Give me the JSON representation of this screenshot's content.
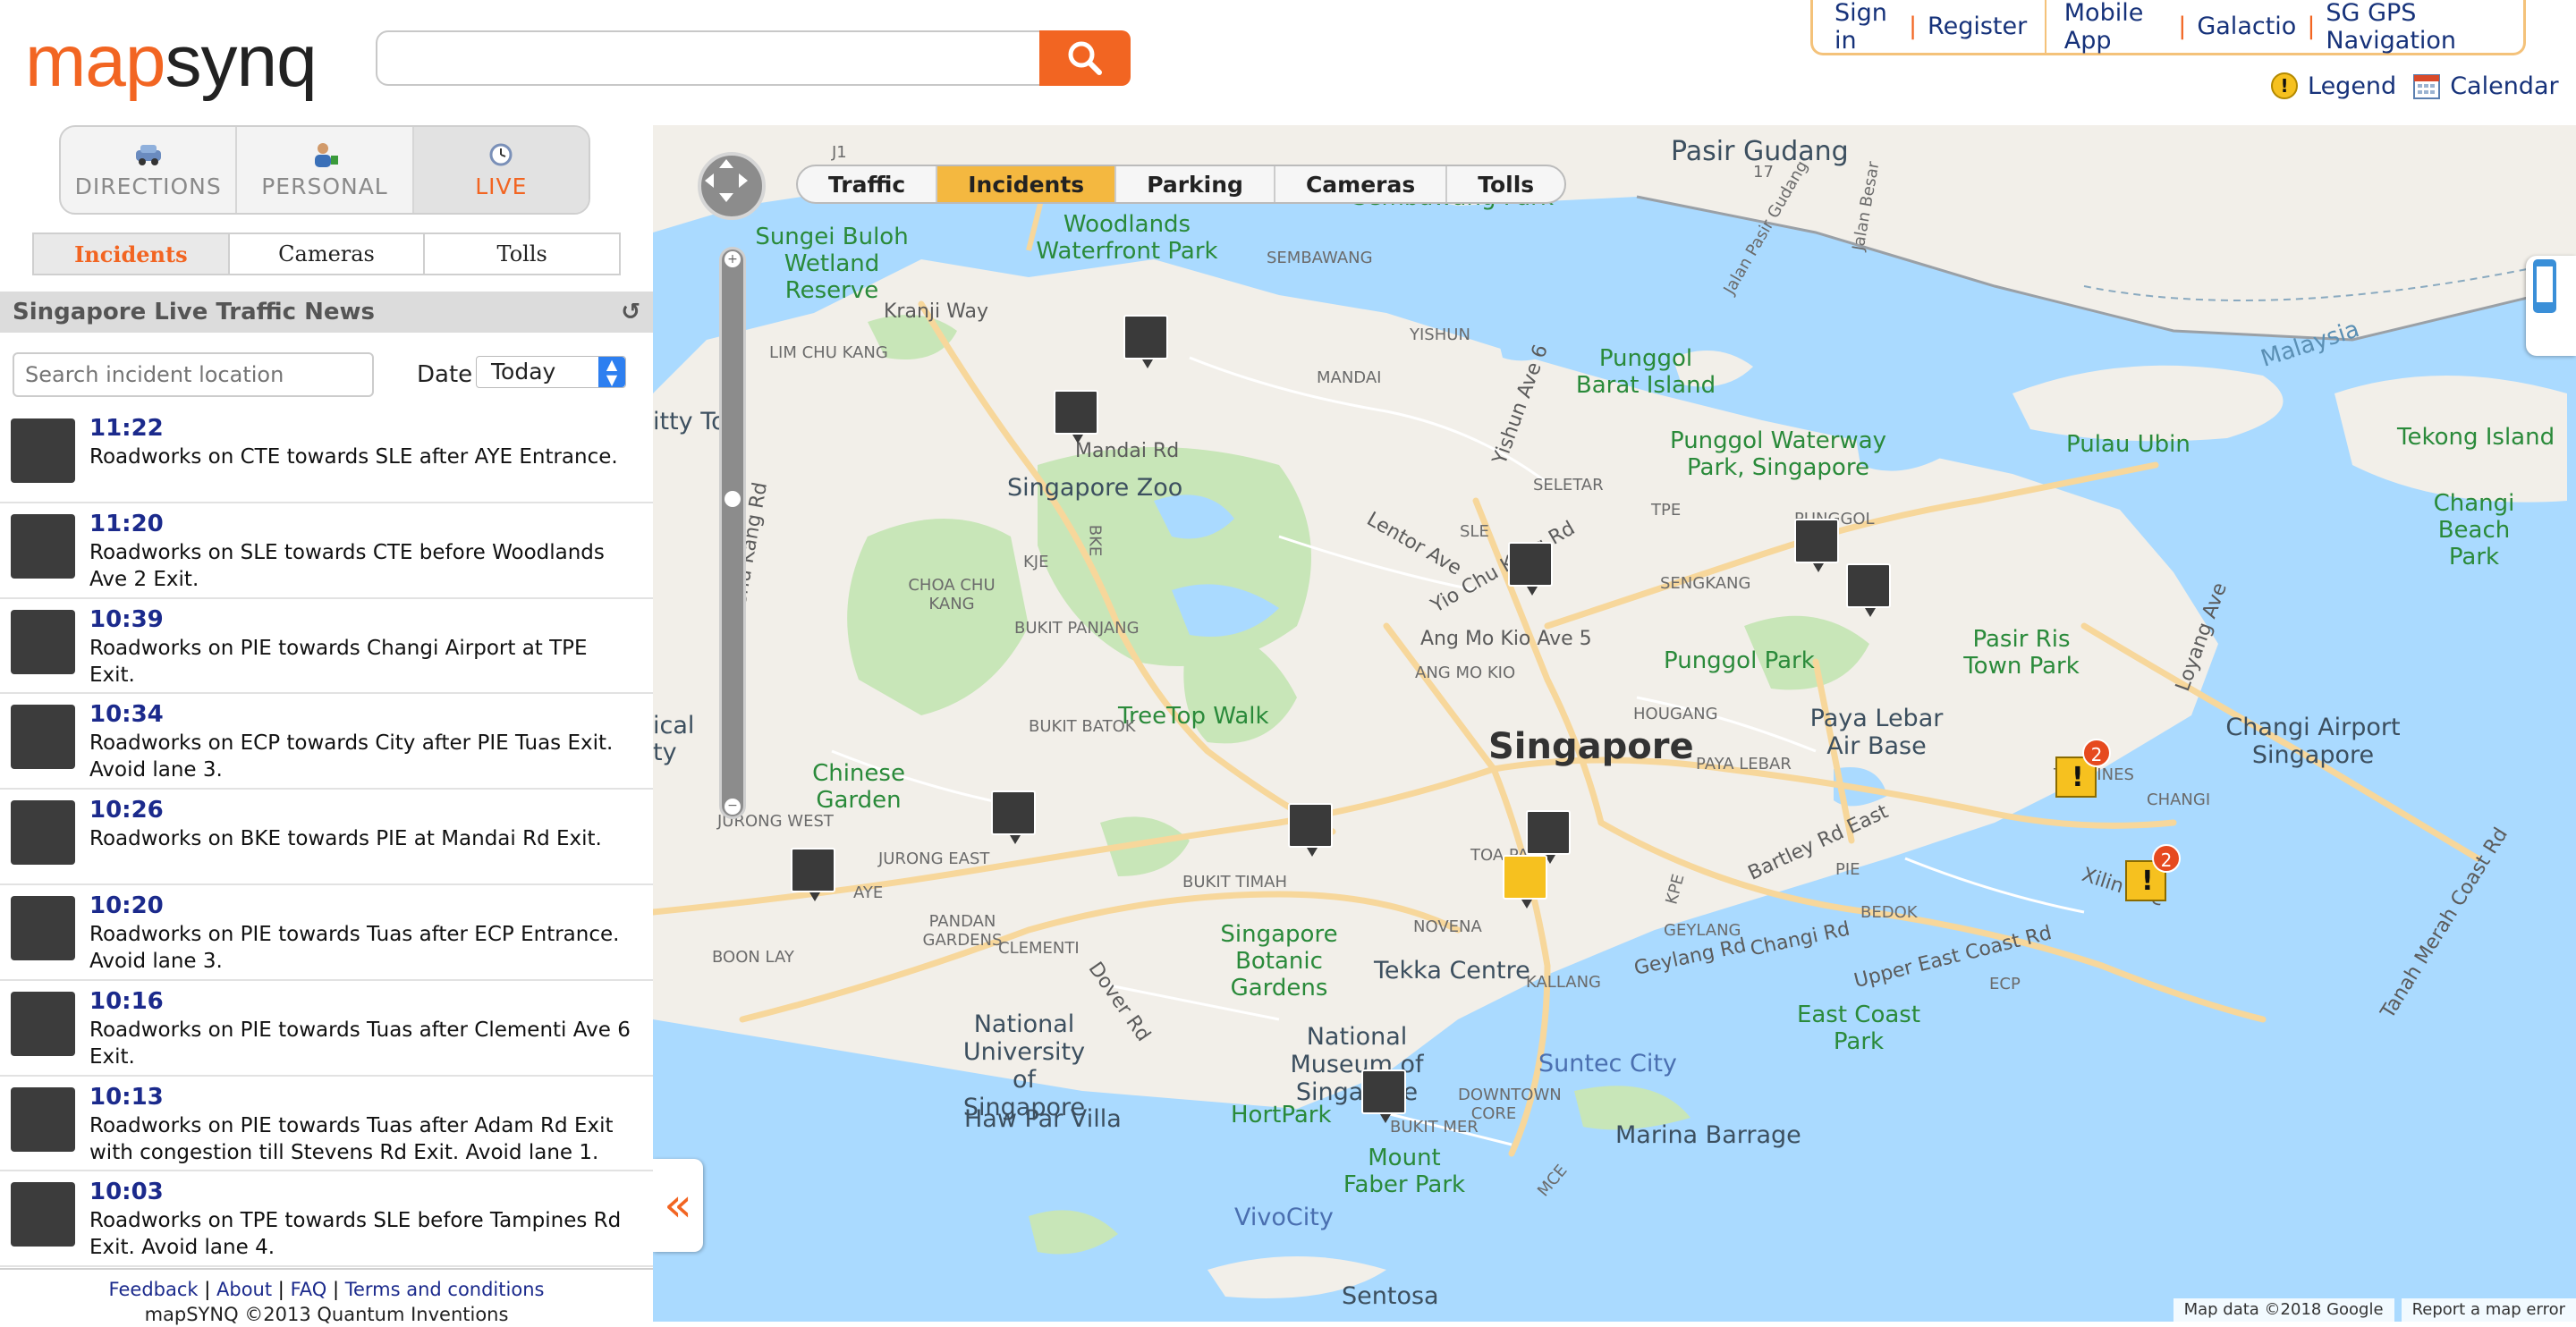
{
  "header": {
    "logo_left": "map",
    "logo_right": "synq",
    "search": {
      "value": "",
      "placeholder": ""
    },
    "links": {
      "sign_in": "Sign in",
      "sep": "|",
      "register": "Register",
      "mobile_app": "Mobile App",
      "galactio": "Galactio",
      "sg_gps": "SG GPS Navigation"
    },
    "legend": "Legend",
    "calendar": "Calendar"
  },
  "sidebar": {
    "mode_tabs": [
      {
        "label": "DIRECTIONS",
        "icon": "car-icon",
        "active": false
      },
      {
        "label": "PERSONAL",
        "icon": "person-icon",
        "active": false
      },
      {
        "label": "LIVE",
        "icon": "clock-icon",
        "active": true
      }
    ],
    "sub_tabs": [
      {
        "label": "Incidents",
        "active": true
      },
      {
        "label": "Cameras",
        "active": false
      },
      {
        "label": "Tolls",
        "active": false
      }
    ],
    "news_title": "Singapore Live Traffic News",
    "incident_search": {
      "value": "",
      "placeholder": "Search incident location"
    },
    "date_label": "Date",
    "date_selected": "Today",
    "incidents": [
      {
        "time": "11:22",
        "desc": "Roadworks on CTE towards SLE after AYE Entrance."
      },
      {
        "time": "11:20",
        "desc": "Roadworks on SLE towards CTE before Woodlands Ave 2 Exit."
      },
      {
        "time": "10:39",
        "desc": "Roadworks on PIE towards Changi Airport at TPE Exit."
      },
      {
        "time": "10:34",
        "desc": "Roadworks on ECP towards City after PIE Tuas Exit. Avoid lane 3."
      },
      {
        "time": "10:26",
        "desc": "Roadworks on BKE towards PIE at Mandai Rd Exit."
      },
      {
        "time": "10:20",
        "desc": "Roadworks on PIE towards Tuas after ECP Entrance. Avoid lane 3."
      },
      {
        "time": "10:16",
        "desc": "Roadworks on PIE towards Tuas after Clementi Ave 6 Exit."
      },
      {
        "time": "10:13",
        "desc": "Roadworks on PIE towards Tuas after Adam Rd Exit with congestion till Stevens Rd Exit. Avoid lane 1."
      },
      {
        "time": "10:03",
        "desc": "Roadworks on TPE towards SLE before Tampines Rd Exit. Avoid lane 4."
      }
    ],
    "footer": {
      "feedback": "Feedback",
      "about": "About",
      "faq": "FAQ",
      "terms": "Terms and conditions",
      "sep": "|",
      "copyright": "mapSYNQ ©2013 Quantum Inventions"
    }
  },
  "map": {
    "tabs": [
      {
        "label": "Traffic",
        "active": false
      },
      {
        "label": "Incidents",
        "active": true
      },
      {
        "label": "Parking",
        "active": false
      },
      {
        "label": "Cameras",
        "active": false
      },
      {
        "label": "Tolls",
        "active": false
      }
    ],
    "labels": {
      "singapore": "Singapore",
      "pasir_gudang": "Pasir Gudang",
      "woodlands_waterfront": "Woodlands Waterfront Park",
      "sembawang_park": "Sembawang Park",
      "sungei_buloh": "Sungei Buloh Wetland Reserve",
      "punggol_barat": "Punggol Barat Island",
      "punggol_waterway": "Punggol Waterway Park, Singapore",
      "pulau_ubin": "Pulau Ubin",
      "tekong": "Tekong Island",
      "changi_beach": "Changi Beach Park",
      "zoo": "Singapore Zoo",
      "punggol_park": "Punggol Park",
      "pasir_ris": "Pasir Ris Town Park",
      "changi_airport": "Changi Airport Singapore",
      "paya_lebar": "Paya Lebar Air Base",
      "treetop": "TreeTop Walk",
      "chinese_garden": "Chinese Garden",
      "botanic": "Singapore Botanic Gardens",
      "tekka": "Tekka Centre",
      "east_coast": "East Coast Park",
      "nus": "National University of Singapore",
      "national_museum": "National Museum of Singapore",
      "suntec": "Suntec City",
      "haw_par": "Haw Par Villa",
      "hortpark": "HortPark",
      "marina_barrage": "Marina Barrage",
      "mount_faber": "Mount Faber Park",
      "vivocity": "VivoCity",
      "sentosa": "Sentosa",
      "malaysia": "Malaysia",
      "kranji": "Kranji Way",
      "lim_chu_kang": "LIM CHU KANG",
      "sembawang": "SEMBAWANG",
      "yishun": "YISHUN",
      "mandai": "MANDAI",
      "mandai_rd": "Mandai Rd",
      "seletar": "SELETAR",
      "sengkang": "SENGKANG",
      "punggol": "PUNGGOL",
      "choa_chu_kang": "CHOA CHU KANG",
      "bukit_panjang": "BUKIT PANJANG",
      "bukit_batok": "BUKIT BATOK",
      "ang_mo_kio": "ANG MO KIO",
      "hougang": "HOUGANG",
      "paya_lebar_area": "PAYA LEBAR",
      "tampines": "TAMPINES",
      "changi": "CHANGI",
      "jurong_west": "JURONG WEST",
      "jurong_east": "JURONG EAST",
      "boon_lay": "BOON LAY",
      "bukit_timah": "BUKIT TIMAH",
      "pandan": "PANDAN GARDENS",
      "clementi": "CLEMENTI",
      "novena": "NOVENA",
      "toa_payoh": "TOA PA",
      "geylang": "GEYLANG",
      "bedok": "BEDOK",
      "kallang": "KALLANG",
      "downtown": "DOWNTOWN CORE",
      "bukit_merah": "BUKIT MER",
      "xilin": "Xilin Ave",
      "loyang": "Loyang Ave",
      "tanah_merah": "Tanah Merah Coast Rd",
      "ecp": "ECP",
      "pie": "PIE",
      "aye": "AYE",
      "kje": "KJE",
      "bke": "BKE",
      "sle": "SLE",
      "tpe": "TPE",
      "kpe": "KPE",
      "mce": "MCE",
      "changi_rd": "Changi Rd",
      "geylang_rd": "Geylang Rd",
      "upper_east_coast": "Upper East Coast Rd",
      "bartley": "Bartley Rd East",
      "dover": "Dover Rd",
      "yio_chu_kang": "Yio Chu Kang Rd",
      "lentor": "Lentor Ave",
      "ang_mo_kio_ave5": "Ang Mo Kio Ave 5",
      "yishun_ave6": "Yishun Ave 6",
      "lim_chu_kang_rd": "Lim Chu Kang Rd",
      "city_fragment": "itty Tow",
      "ical_fragment": "ical",
      "ty_fragment": "ty",
      "jalan_pasir": "Jalan Pasir Gudang",
      "jalan_besar": "Jalan Besar",
      "j1": "J1",
      "r17": "17"
    },
    "badges": [
      "2",
      "2"
    ],
    "attribution_data": "Map data ©2018 Google",
    "attribution_error": "Report a map error"
  },
  "colors": {
    "brand_orange": "#f26522",
    "link_blue": "#1b2a8c",
    "active_tab_yellow": "#f4b840",
    "water": "#aadaff",
    "land": "#f2efe9",
    "park": "#c8e6b8"
  }
}
